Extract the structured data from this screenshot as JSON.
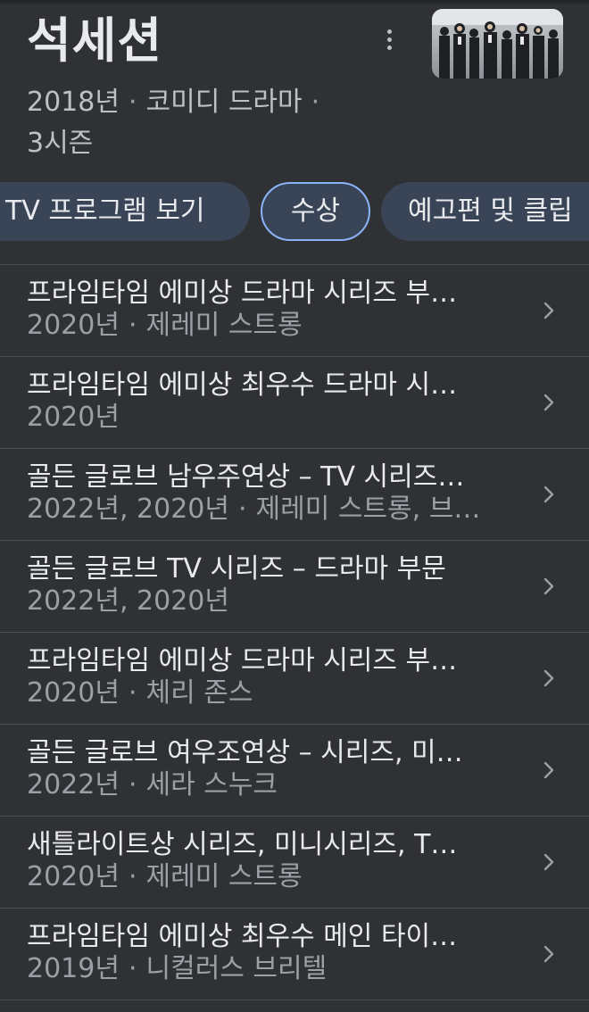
{
  "header": {
    "title": "석세션",
    "meta_year": "2018년",
    "meta_genre": "코미디 드라마",
    "meta_seasons": "3시즌",
    "separator": "·",
    "thumbnail_icon": "show-thumbnail"
  },
  "tabs": [
    {
      "label": "TV 프로그램 보기",
      "selected": false
    },
    {
      "label": "수상",
      "selected": true
    },
    {
      "label": "예고편 및 클립",
      "selected": false
    }
  ],
  "awards": [
    {
      "title": "프라임타임 에미상 드라마 시리즈 부…",
      "year": "2020년",
      "recipient": "제레미 스트롱"
    },
    {
      "title": "프라임타임 에미상 최우수 드라마 시…",
      "year": "2020년",
      "recipient": ""
    },
    {
      "title": "골든 글로브 남우주연상 – TV 시리즈…",
      "year": "2022년, 2020년",
      "recipient": "제레미 스트롱, 브…"
    },
    {
      "title": "골든 글로브 TV 시리즈 – 드라마 부문",
      "year": "2022년, 2020년",
      "recipient": ""
    },
    {
      "title": "프라임타임 에미상 드라마 시리즈 부…",
      "year": "2020년",
      "recipient": "체리 존스"
    },
    {
      "title": "골든 글로브 여우조연상 – 시리즈, 미…",
      "year": "2022년",
      "recipient": "세라 스누크"
    },
    {
      "title": "새틀라이트상 시리즈, 미니시리즈, T…",
      "year": "2020년",
      "recipient": "제레미 스트롱"
    },
    {
      "title": "프라임타임 에미상 최우수 메인 타이…",
      "year": "2019년",
      "recipient": "니컬러스 브리텔"
    }
  ],
  "colors": {
    "background": "#303134",
    "chip": "#394457",
    "chip_selected_border": "#8ab4f8",
    "text_primary": "#e8eaed",
    "text_secondary": "#9aa0a6"
  }
}
